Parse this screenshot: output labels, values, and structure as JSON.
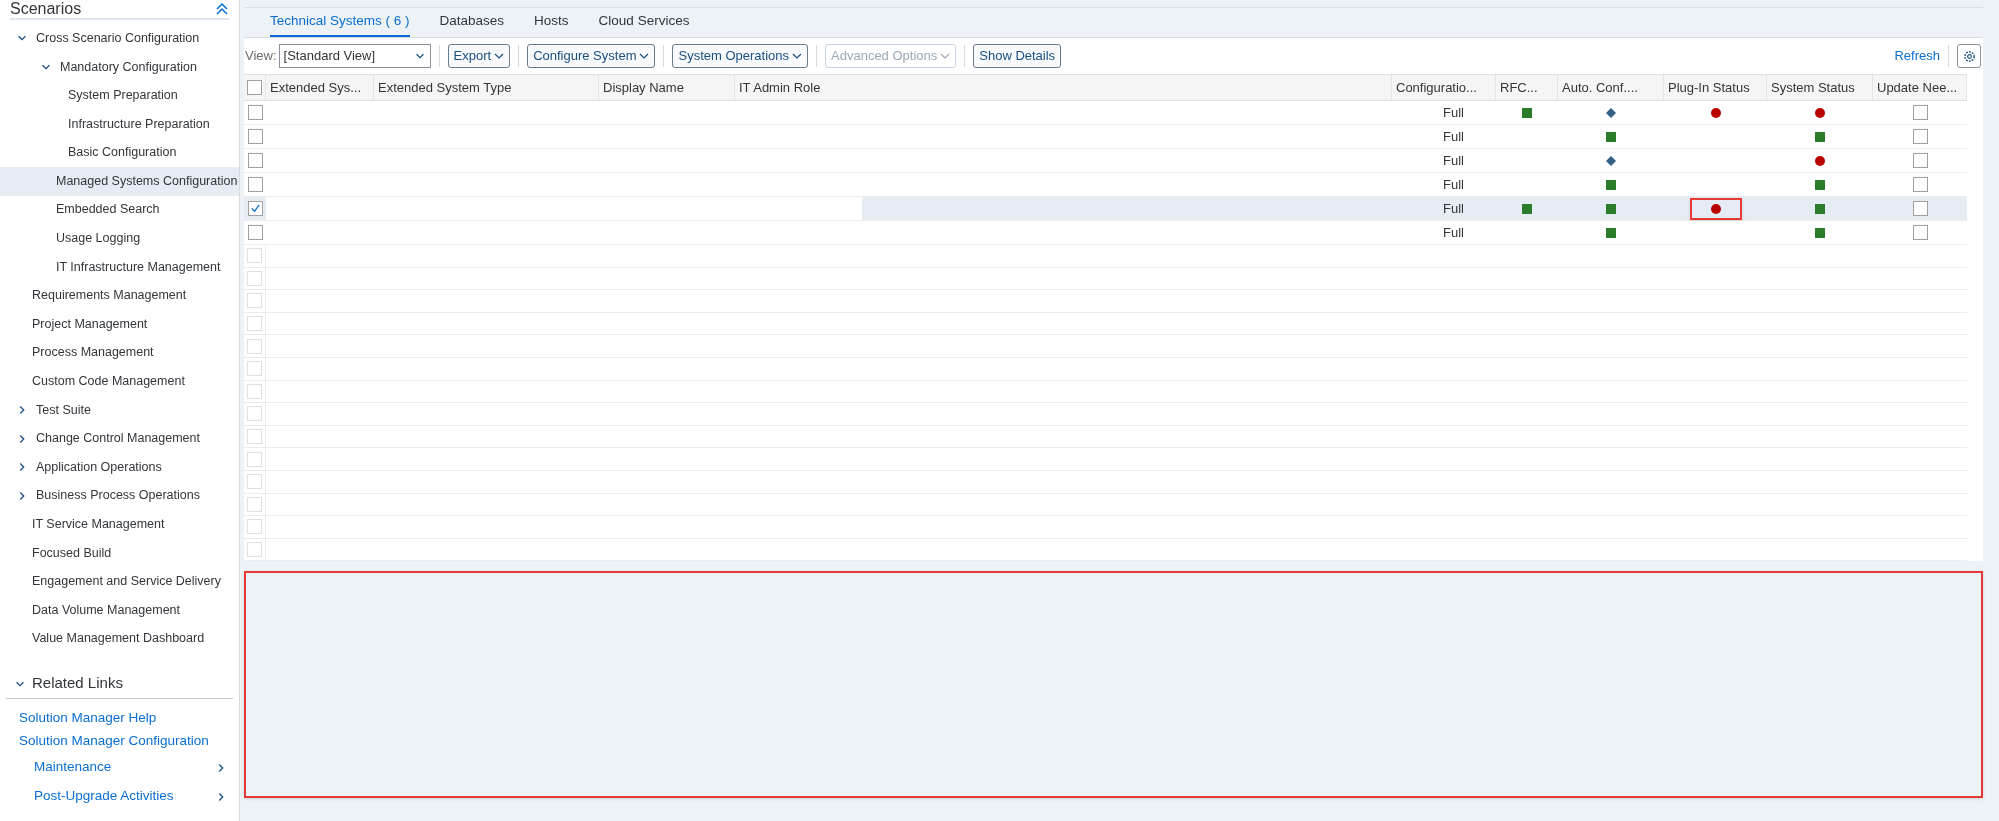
{
  "sidebar": {
    "title": "Scenarios",
    "items": [
      {
        "label": "Cross Scenario Configuration",
        "expanded": true,
        "selected": false,
        "children": [
          {
            "label": "Mandatory Configuration",
            "expanded": true,
            "selected": false,
            "children": [
              {
                "label": "System Preparation",
                "selected": false
              },
              {
                "label": "Infrastructure Preparation",
                "selected": false
              },
              {
                "label": "Basic Configuration",
                "selected": false
              }
            ]
          },
          {
            "label": "Managed Systems Configuration",
            "selected": true
          },
          {
            "label": "Embedded Search",
            "selected": false
          },
          {
            "label": "Usage Logging",
            "selected": false
          },
          {
            "label": "IT Infrastructure Management",
            "selected": false
          }
        ]
      },
      {
        "label": "Requirements Management",
        "selected": false
      },
      {
        "label": "Project Management",
        "selected": false
      },
      {
        "label": "Process Management",
        "selected": false
      },
      {
        "label": "Custom Code Management",
        "selected": false
      },
      {
        "label": "Test Suite",
        "expanded": false,
        "selected": false
      },
      {
        "label": "Change Control Management",
        "expanded": false,
        "selected": false
      },
      {
        "label": "Application Operations",
        "expanded": false,
        "selected": false
      },
      {
        "label": "Business Process Operations",
        "expanded": false,
        "selected": false
      },
      {
        "label": "IT Service Management",
        "selected": false
      },
      {
        "label": "Focused Build",
        "selected": false
      },
      {
        "label": "Engagement and Service Delivery",
        "selected": false
      },
      {
        "label": "Data Volume Management",
        "selected": false
      },
      {
        "label": "Value Management Dashboard",
        "selected": false
      }
    ]
  },
  "related_links": {
    "title": "Related Links",
    "expanded": true,
    "links": [
      {
        "label": "Solution Manager Help",
        "kind": "link"
      },
      {
        "label": "Solution Manager Configuration",
        "kind": "link"
      },
      {
        "label": "Maintenance",
        "kind": "submenu"
      },
      {
        "label": "Post-Upgrade Activities",
        "kind": "submenu"
      }
    ]
  },
  "tabs": [
    {
      "label": "Technical Systems ( 6 )",
      "selected": true
    },
    {
      "label": "Databases",
      "selected": false
    },
    {
      "label": "Hosts",
      "selected": false
    },
    {
      "label": "Cloud Services",
      "selected": false
    }
  ],
  "toolbar": {
    "view_label": "View:",
    "view_value": "[Standard View]",
    "buttons": [
      {
        "label": "Export",
        "menu": true,
        "disabled": false
      },
      {
        "label": "Configure System",
        "menu": true,
        "disabled": false
      },
      {
        "label": "System Operations",
        "menu": true,
        "disabled": false
      },
      {
        "label": "Advanced Options",
        "menu": true,
        "disabled": true
      },
      {
        "label": "Show Details",
        "menu": false,
        "disabled": false
      }
    ],
    "refresh": "Refresh"
  },
  "table": {
    "select_all_checked": false,
    "columns": [
      "Extended Sys...",
      "Extended System Type",
      "Display Name",
      "IT Admin Role",
      "Configuratio...",
      "RFC...",
      "Auto. Conf....",
      "Plug-In Status",
      "System Status",
      "Update Nee..."
    ],
    "rows": [
      {
        "selected": false,
        "configuration": "Full",
        "rfc": {
          "kind": "square",
          "color": "#2b7d2b"
        },
        "auto_conf": {
          "kind": "diamond",
          "color": "#346187"
        },
        "plugin": {
          "kind": "dot",
          "color": "#bb0000"
        },
        "plugin_highlighted": false,
        "system_status": {
          "kind": "dot",
          "color": "#bb0000"
        },
        "update_needed": false
      },
      {
        "selected": false,
        "configuration": "Full",
        "rfc": null,
        "auto_conf": {
          "kind": "square",
          "color": "#2b7d2b"
        },
        "plugin": null,
        "plugin_highlighted": false,
        "system_status": {
          "kind": "square",
          "color": "#2b7d2b"
        },
        "update_needed": false
      },
      {
        "selected": false,
        "configuration": "Full",
        "rfc": null,
        "auto_conf": {
          "kind": "diamond",
          "color": "#346187"
        },
        "plugin": null,
        "plugin_highlighted": false,
        "system_status": {
          "kind": "dot",
          "color": "#bb0000"
        },
        "update_needed": false
      },
      {
        "selected": false,
        "configuration": "Full",
        "rfc": null,
        "auto_conf": {
          "kind": "square",
          "color": "#2b7d2b"
        },
        "plugin": null,
        "plugin_highlighted": false,
        "system_status": {
          "kind": "square",
          "color": "#2b7d2b"
        },
        "update_needed": false
      },
      {
        "selected": true,
        "configuration": "Full",
        "rfc": {
          "kind": "square",
          "color": "#2b7d2b"
        },
        "auto_conf": {
          "kind": "square",
          "color": "#2b7d2b"
        },
        "plugin": {
          "kind": "dot",
          "color": "#bb0000"
        },
        "plugin_highlighted": true,
        "system_status": {
          "kind": "square",
          "color": "#2b7d2b"
        },
        "update_needed": false
      },
      {
        "selected": false,
        "configuration": "Full",
        "rfc": null,
        "auto_conf": {
          "kind": "square",
          "color": "#2b7d2b"
        },
        "plugin": null,
        "plugin_highlighted": false,
        "system_status": {
          "kind": "square",
          "color": "#2b7d2b"
        },
        "update_needed": false
      }
    ],
    "empty_rows": [
      {
        "selected": false
      },
      {
        "selected": false
      },
      {
        "selected": false
      },
      {
        "selected": false
      },
      {
        "selected": false
      },
      {
        "selected": false
      },
      {
        "selected": false
      },
      {
        "selected": false
      },
      {
        "selected": false
      },
      {
        "selected": false
      },
      {
        "selected": false
      },
      {
        "selected": false
      },
      {
        "selected": false
      },
      {
        "selected": false
      }
    ]
  },
  "details_panel": {
    "highlighted": true
  }
}
